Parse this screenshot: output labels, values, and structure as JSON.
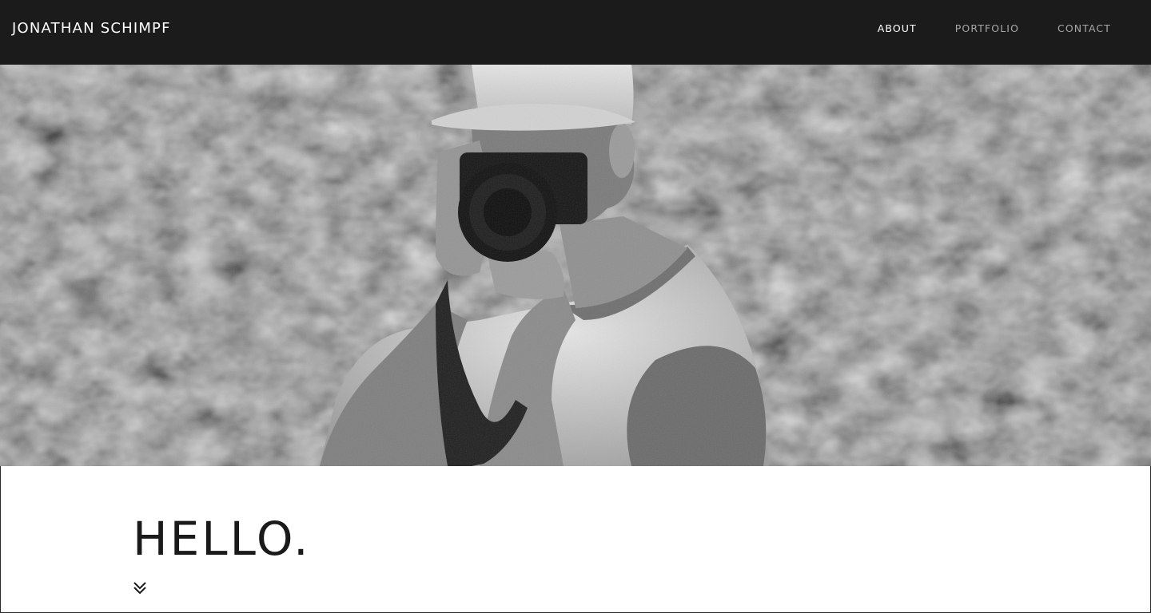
{
  "site": {
    "title": "JONATHAN SCHIMPF"
  },
  "nav": {
    "items": [
      {
        "label": "ABOUT",
        "active": true
      },
      {
        "label": "PORTFOLIO",
        "active": false
      },
      {
        "label": "CONTACT",
        "active": false
      }
    ]
  },
  "hero": {
    "image_description_icon": "photo-of-photographer-with-camera"
  },
  "content": {
    "heading": "HELLO.",
    "scroll_icon": "double-chevron-down-icon"
  },
  "colors": {
    "header_bg": "#1b1b1b",
    "nav_active": "#ffffff",
    "nav_inactive": "#a8a8a8",
    "heading": "#1a1a1a"
  }
}
